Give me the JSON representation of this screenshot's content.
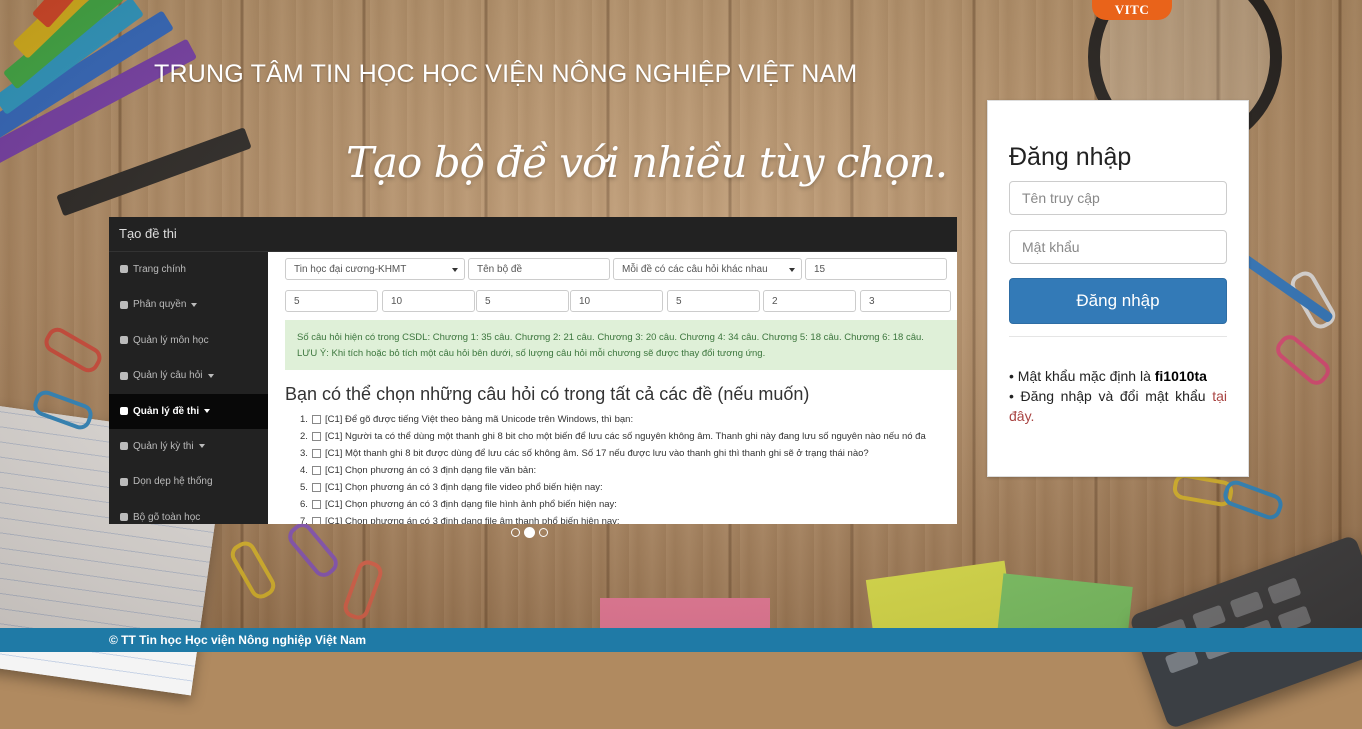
{
  "brand_tab": "VITC",
  "site_title": "TRUNG TÂM TIN HỌC HỌC VIỆN NÔNG NGHIỆP VIỆT NAM",
  "slogan": "Tạo bộ đề với nhiều tùy chọn.",
  "slide": {
    "header": "Tạo đề thi",
    "sidebar": [
      {
        "label": "Trang chính",
        "icon": "dashboard-icon",
        "caret": false,
        "active": false
      },
      {
        "label": "Phân quyền",
        "icon": "user-icon",
        "caret": true,
        "active": false
      },
      {
        "label": "Quản lý môn học",
        "icon": "book-icon",
        "caret": false,
        "active": false
      },
      {
        "label": "Quản lý câu hỏi",
        "icon": "question-icon",
        "caret": true,
        "active": false
      },
      {
        "label": "Quản lý đề thi",
        "icon": "table-icon",
        "caret": true,
        "active": true
      },
      {
        "label": "Quản lý kỳ thi",
        "icon": "check-icon",
        "caret": true,
        "active": false
      },
      {
        "label": "Dọn dẹp hệ thống",
        "icon": "trash-icon",
        "caret": false,
        "active": false
      },
      {
        "label": "Bộ gõ toàn học",
        "icon": "keyboard-icon",
        "caret": false,
        "active": false
      }
    ],
    "form_row1": {
      "subject": "Tin học đại cương-KHMT",
      "set_name_placeholder": "Tên bộ đề",
      "mode": "Mỗi đề có các câu hỏi khác nhau",
      "count": "15"
    },
    "form_row2": [
      "5",
      "10",
      "5",
      "10",
      "5",
      "2",
      "3"
    ],
    "alert_line1": "Số câu hỏi hiện có trong CSDL: Chương 1: 35 câu. Chương 2: 21 câu. Chương 3: 20 câu. Chương 4: 34 câu. Chương 5: 18 câu. Chương 6: 18 câu.",
    "alert_line2": "LƯU Ý: Khi tích hoặc bỏ tích một câu hỏi bên dưới, số lượng câu hỏi mỗi chương sẽ được thay đổi tương ứng.",
    "questions_title": "Bạn có thể chọn những câu hỏi có trong tất cả các đề (nếu muốn)",
    "questions": [
      {
        "num": "1.",
        "text": "[C1] Để gõ được tiếng Việt theo bảng mã Unicode trên Windows, thì bạn:"
      },
      {
        "num": "2.",
        "text": "[C1] Người ta có thể dùng một thanh ghi 8 bit cho một biến để lưu các số nguyên không âm. Thanh ghi này đang lưu số nguyên nào nếu nó đa"
      },
      {
        "num": "3.",
        "text": "[C1] Một thanh ghi 8 bit được dùng để lưu các số không âm. Số 17 nếu được lưu vào thanh ghi thì thanh ghi sẽ ở trạng thái nào?"
      },
      {
        "num": "4.",
        "text": "[C1] Chọn phương án có 3 định dạng file văn bản:"
      },
      {
        "num": "5.",
        "text": "[C1] Chọn phương án có 3 định dạng file video phổ biến hiện nay:"
      },
      {
        "num": "6.",
        "text": "[C1] Chọn phương án có 3 định dạng file hình ảnh phổ biến hiện nay:"
      },
      {
        "num": "7.",
        "text": "[C1] Chọn phương án có 3 định dạng file âm thanh phổ biến hiện nay:"
      }
    ]
  },
  "carousel": {
    "count": 3,
    "active_index": 1
  },
  "login": {
    "title": "Đăng nhập",
    "username_placeholder": "Tên truy cập",
    "password_placeholder": "Mật khẩu",
    "submit_label": "Đăng nhập",
    "note1_prefix": "• Mật khẩu mặc định là ",
    "note1_value": "fi1010ta",
    "note2_prefix": "• Đăng nhập và đổi mật khẩu ",
    "note2_link": "tại đây",
    "note2_suffix": "."
  },
  "footer": "© TT Tin học Học viện Nông nghiệp Việt Nam",
  "colors": {
    "brand_tab": "#e9631a",
    "login_button": "#337ab7",
    "footer": "#1f7aa6",
    "alert_bg": "#dff0d8",
    "link": "#a94442"
  }
}
